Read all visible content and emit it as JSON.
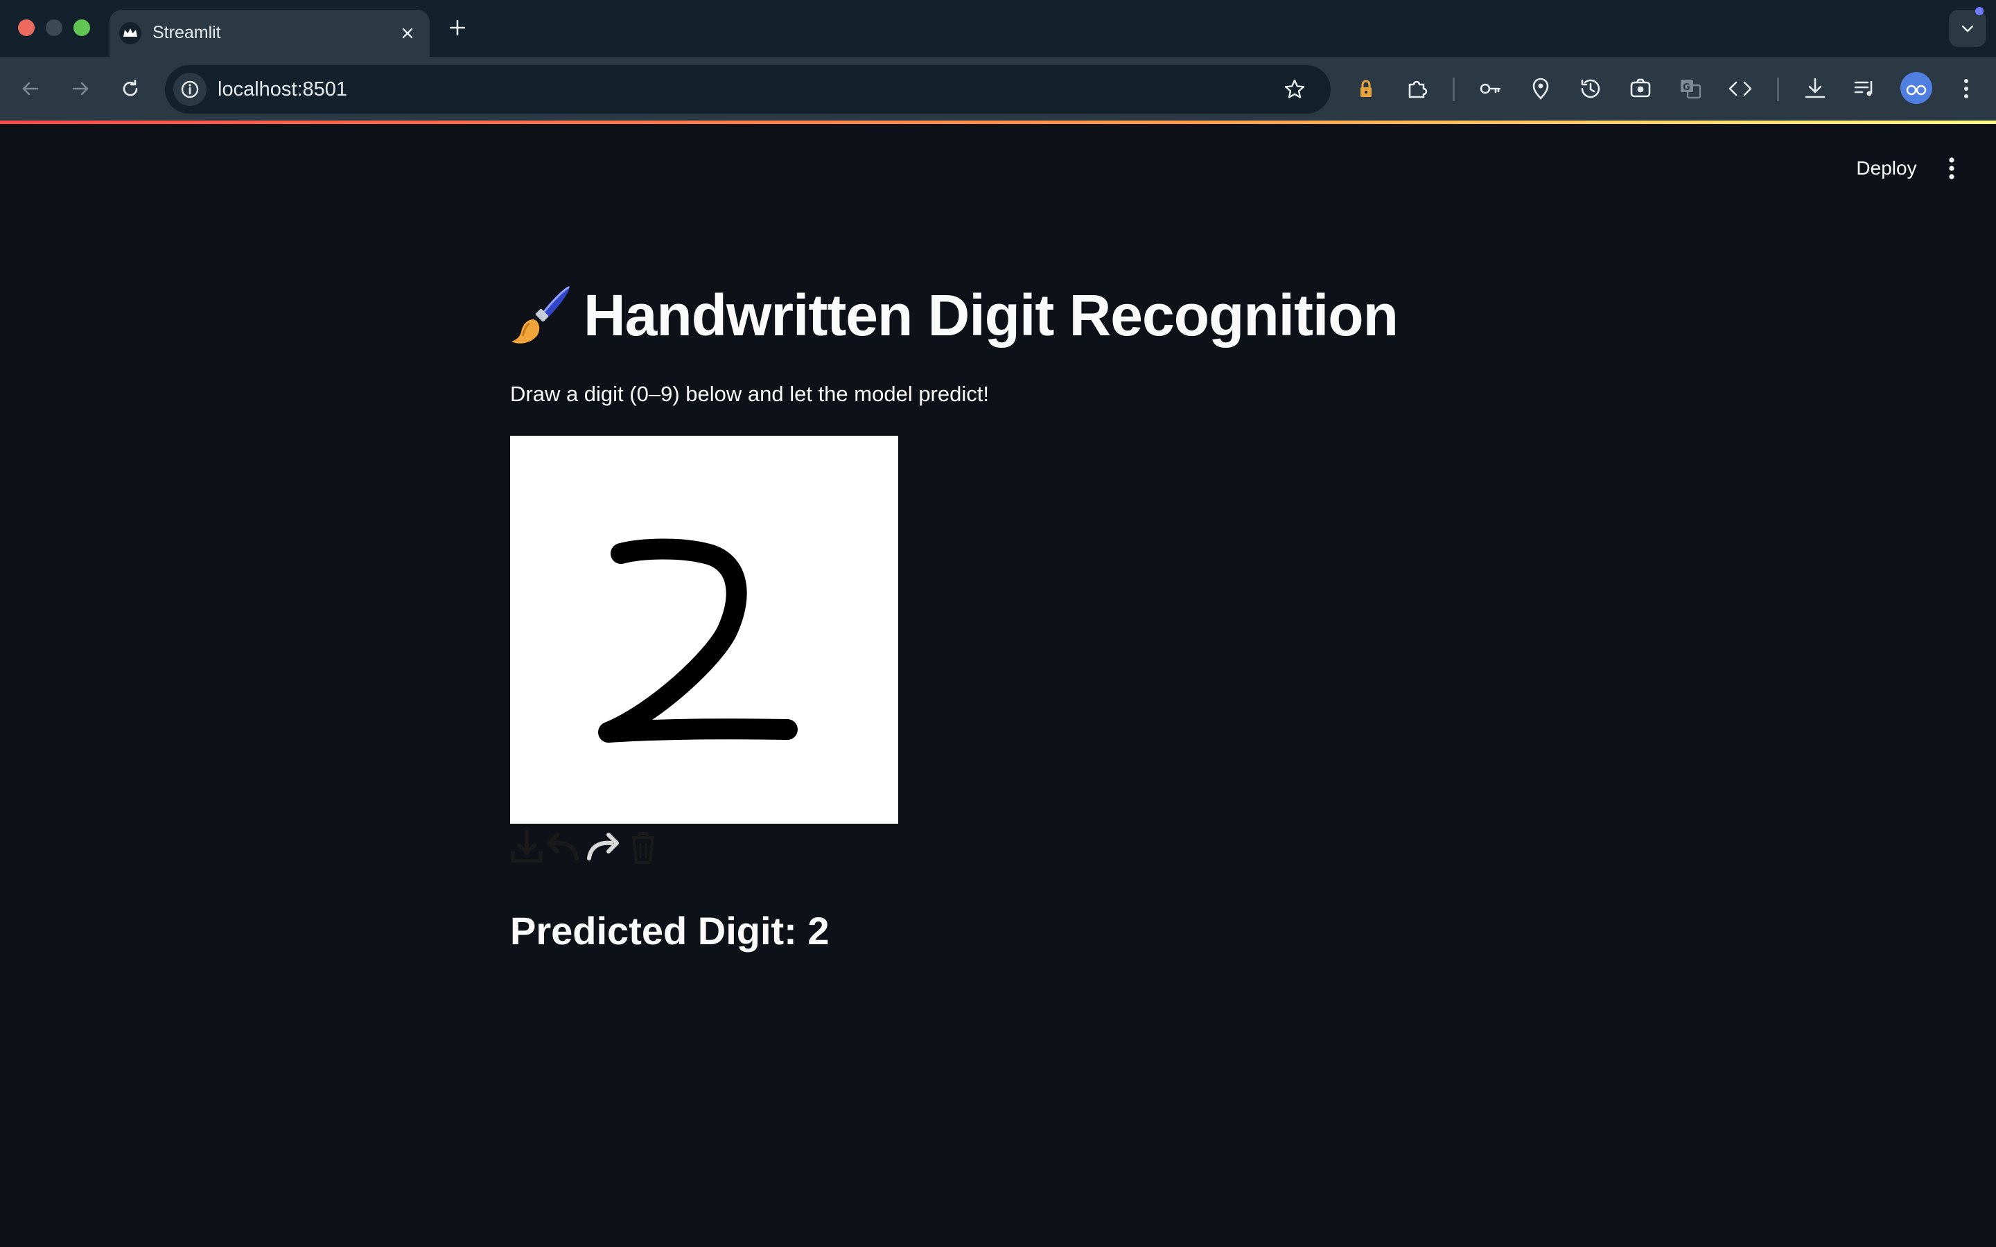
{
  "browser": {
    "tab_title": "Streamlit",
    "url": "localhost:8501"
  },
  "app": {
    "header": {
      "deploy_label": "Deploy"
    },
    "title_icon": "paintbrush-icon",
    "title": "Handwritten Digit Recognition",
    "subtitle": "Draw a digit (0–9) below and let the model predict!",
    "canvas": {
      "drawn_digit": "2",
      "background": "#ffffff",
      "stroke_color": "#000000",
      "tools": [
        "download-icon",
        "undo-icon",
        "redo-icon",
        "trash-icon"
      ]
    },
    "prediction": "Predicted Digit: 2"
  },
  "colors": {
    "app_background": "#0e1117",
    "text": "#fafafa",
    "chrome_dark": "#12212b",
    "chrome_light": "#2a3944"
  }
}
